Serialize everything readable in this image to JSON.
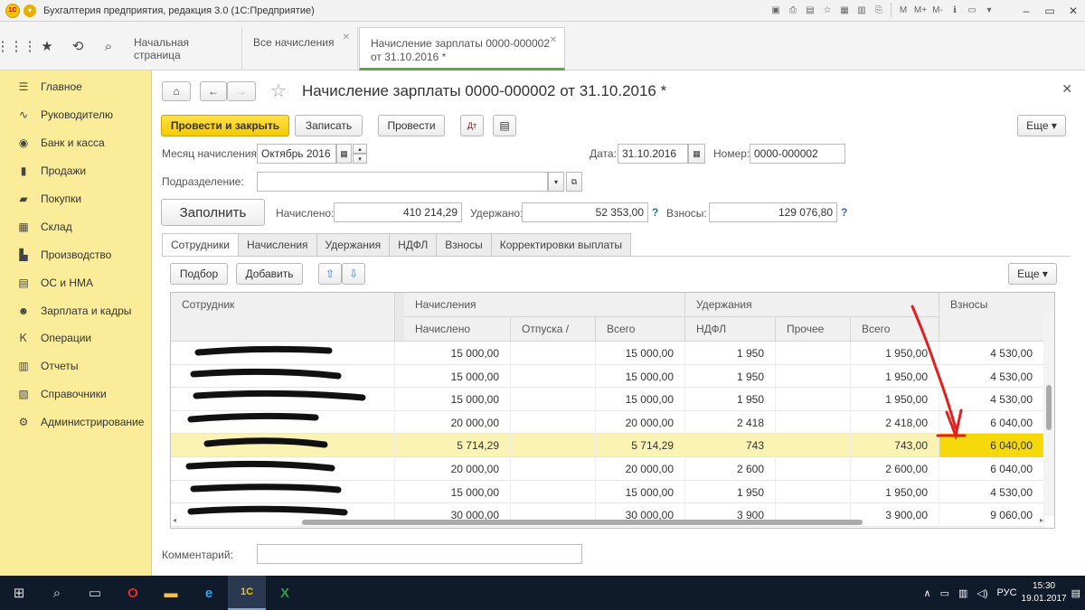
{
  "window": {
    "title": "Бухгалтерия предприятия, редакция 3.0  (1С:Предприятие)",
    "logo_text": "1С"
  },
  "tabs": [
    {
      "label": "Начальная страница"
    },
    {
      "label": "Все начисления"
    },
    {
      "label_line1": "Начисление зарплаты 0000-000002",
      "label_line2": "от 31.10.2016 *"
    }
  ],
  "sidebar": {
    "items": [
      {
        "label": "Главное",
        "icon": "menu-icon"
      },
      {
        "label": "Руководителю",
        "icon": "chart-icon"
      },
      {
        "label": "Банк и касса",
        "icon": "coin-icon"
      },
      {
        "label": "Продажи",
        "icon": "bag-icon"
      },
      {
        "label": "Покупки",
        "icon": "cart-icon"
      },
      {
        "label": "Склад",
        "icon": "warehouse-icon"
      },
      {
        "label": "Производство",
        "icon": "factory-icon"
      },
      {
        "label": "ОС и НМА",
        "icon": "assets-icon"
      },
      {
        "label": "Зарплата и кадры",
        "icon": "people-icon"
      },
      {
        "label": "Операции",
        "icon": "operations-icon"
      },
      {
        "label": "Отчеты",
        "icon": "report-icon"
      },
      {
        "label": "Справочники",
        "icon": "book-icon"
      },
      {
        "label": "Администрирование",
        "icon": "gear-icon"
      }
    ]
  },
  "document": {
    "title": "Начисление зарплаты 0000-000002 от 31.10.2016 *",
    "toolbar": {
      "post_and_close": "Провести и закрыть",
      "save": "Записать",
      "post": "Провести",
      "more": "Еще"
    },
    "month_label": "Месяц начисления:",
    "month_value": "Октябрь 2016",
    "date_label": "Дата:",
    "date_value": "31.10.2016",
    "number_label": "Номер:",
    "number_value": "0000-000002",
    "department_label": "Подразделение:",
    "department_value": "",
    "fill_button": "Заполнить",
    "accrued_label": "Начислено:",
    "accrued_value": "410 214,29",
    "withheld_label": "Удержано:",
    "withheld_value": "52 353,00",
    "contrib_label": "Взносы:",
    "contrib_value": "129 076,80",
    "help_mark": "?",
    "comment_label": "Комментарий:",
    "comment_value": ""
  },
  "form_tabs": [
    "Сотрудники",
    "Начисления",
    "Удержания",
    "НДФЛ",
    "Взносы",
    "Корректировки выплаты"
  ],
  "table_toolbar": {
    "select": "Подбор",
    "add": "Добавить",
    "more": "Еще"
  },
  "table": {
    "header_groups": {
      "employee": "Сотрудник",
      "accruals": "Начисления",
      "deductions": "Удержания",
      "contributions": "Взносы"
    },
    "subheaders": {
      "accrued": "Начислено",
      "vacation": "Отпуска /",
      "total": "Всего",
      "ndfl": "НДФЛ",
      "other": "Прочее",
      "total2": "Всего"
    },
    "rows": [
      {
        "accrued": "15 000,00",
        "vacation": "",
        "total": "15 000,00",
        "ndfl": "1 950",
        "other": "",
        "total2": "1 950,00",
        "contrib": "4 530,00"
      },
      {
        "accrued": "15 000,00",
        "vacation": "",
        "total": "15 000,00",
        "ndfl": "1 950",
        "other": "",
        "total2": "1 950,00",
        "contrib": "4 530,00"
      },
      {
        "accrued": "15 000,00",
        "vacation": "",
        "total": "15 000,00",
        "ndfl": "1 950",
        "other": "",
        "total2": "1 950,00",
        "contrib": "4 530,00"
      },
      {
        "accrued": "20 000,00",
        "vacation": "",
        "total": "20 000,00",
        "ndfl": "2 418",
        "other": "",
        "total2": "2 418,00",
        "contrib": "6 040,00"
      },
      {
        "accrued": "5 714,29",
        "vacation": "",
        "total": "5 714,29",
        "ndfl": "743",
        "other": "",
        "total2": "743,00",
        "contrib": "6 040,00"
      },
      {
        "accrued": "20 000,00",
        "vacation": "",
        "total": "20 000,00",
        "ndfl": "2 600",
        "other": "",
        "total2": "2 600,00",
        "contrib": "6 040,00"
      },
      {
        "accrued": "15 000,00",
        "vacation": "",
        "total": "15 000,00",
        "ndfl": "1 950",
        "other": "",
        "total2": "1 950,00",
        "contrib": "4 530,00"
      },
      {
        "accrued": "30 000,00",
        "vacation": "",
        "total": "30 000,00",
        "ndfl": "3 900",
        "other": "",
        "total2": "3 900,00",
        "contrib": "9 060,00"
      }
    ],
    "selected_row": 4
  },
  "colors": {
    "sidebar_bg": "#fbec9a",
    "primary_button": "#f6c900",
    "selected_row": "#fbf3b4",
    "highlight_cell": "#f5d90a",
    "annotation_arrow": "#e02020",
    "active_tab_underline": "#56a93a",
    "taskbar": "#0f1a2b"
  },
  "taskbar": {
    "lang": "РУС",
    "time": "15:30",
    "date": "19.01.2017"
  }
}
